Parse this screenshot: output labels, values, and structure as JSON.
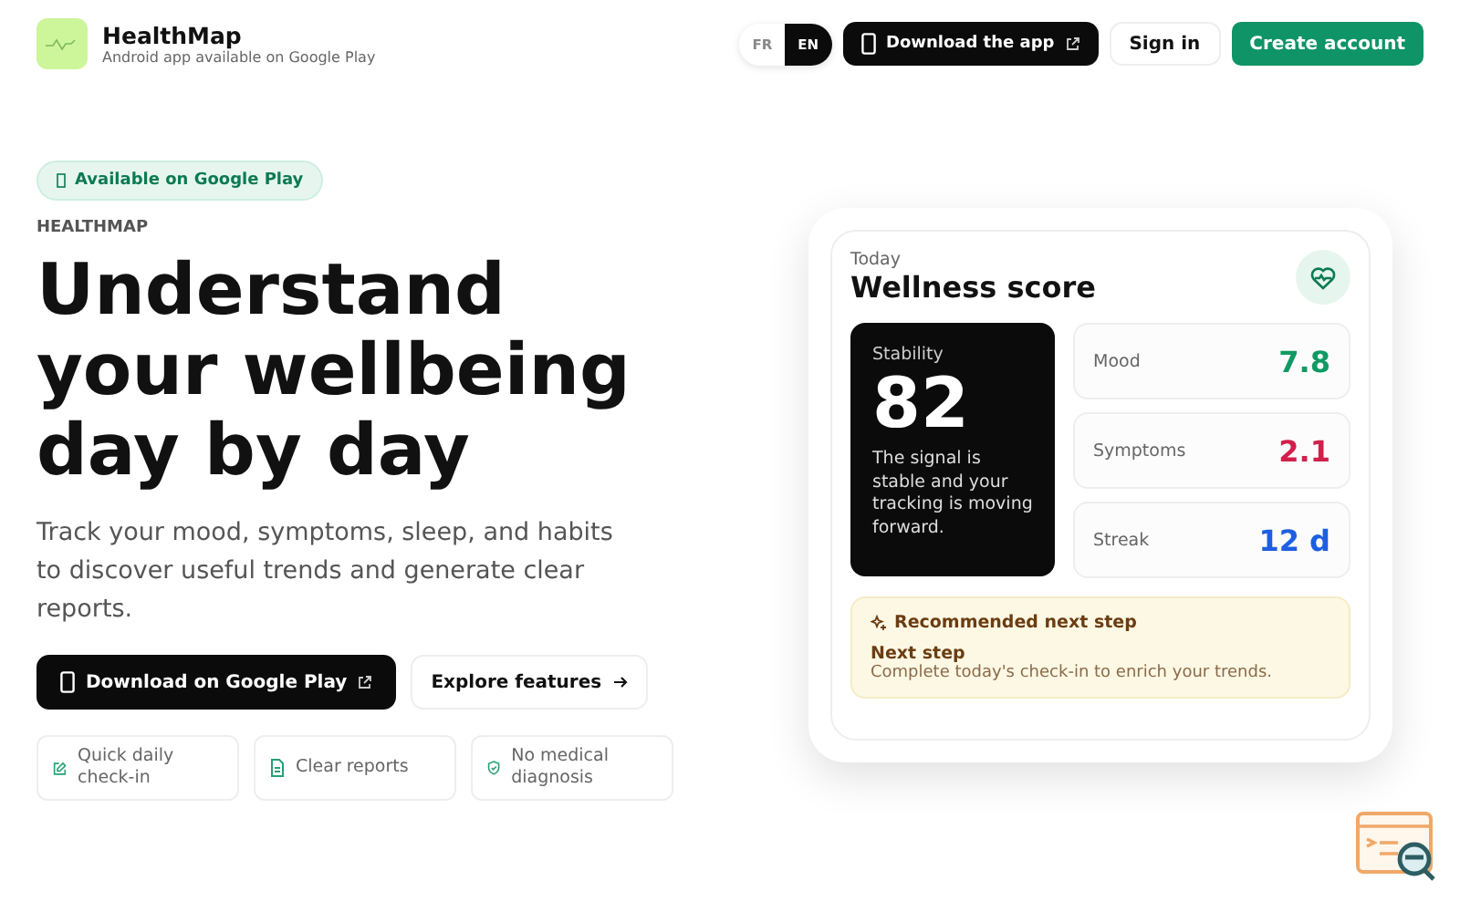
{
  "brand": {
    "name": "HealthMap",
    "tagline": "Android app available on Google Play"
  },
  "languages": [
    {
      "label": "FR",
      "selected": false
    },
    {
      "label": "EN",
      "selected": true
    }
  ],
  "nav": {
    "download": "Download the app",
    "sign_in": "Sign in",
    "create": "Create account"
  },
  "hero": {
    "badge": "Available on Google Play",
    "eyebrow": "HEALTHMAP",
    "title": "Understand your wellbeing day by day",
    "lead": "Track your mood, symptoms, sleep, and habits to discover useful trends and generate clear reports.",
    "primary": "Download on Google Play",
    "secondary": "Explore features",
    "features": [
      {
        "kind": "checkin",
        "label": "Quick daily check-in"
      },
      {
        "kind": "report",
        "label": "Clear reports"
      },
      {
        "kind": "shield",
        "label": "No medical diagnosis"
      }
    ]
  },
  "card": {
    "eyebrow": "Today",
    "title": "Wellness score",
    "stability": {
      "label": "Stability",
      "value": "82",
      "text": "The signal is stable and your tracking is moving forward."
    },
    "metrics": [
      {
        "label": "Mood",
        "value": "7.8",
        "color": "#0f9a63"
      },
      {
        "label": "Symptoms",
        "value": "2.1",
        "color": "#d21f4b"
      },
      {
        "label": "Streak",
        "value": "12 d",
        "color": "#1d5fe0"
      }
    ],
    "tip": {
      "heading": "Recommended next step",
      "title": "Next step",
      "text": "Complete today's check-in to enrich your trends."
    }
  }
}
